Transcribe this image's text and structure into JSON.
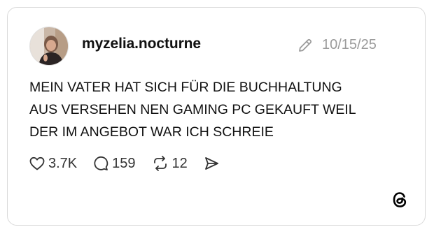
{
  "post": {
    "username": "myzelia.nocturne",
    "timestamp": "10/15/25",
    "text_lines": [
      "MEIN VATER HAT SICH FÜR DIE BUCHHALTUNG",
      "AUS VERSEHEN NEN GAMING PC GEKAUFT WEIL",
      "DER IM ANGEBOT WAR ICH SCHREIE"
    ]
  },
  "actions": {
    "likes": "3.7K",
    "replies": "159",
    "reposts": "12"
  },
  "icons": {
    "edit": "pencil-icon",
    "like": "heart-icon",
    "reply": "speech-bubble-icon",
    "repost": "repost-icon",
    "share": "send-icon",
    "brand": "threads-logo-icon"
  },
  "colors": {
    "text": "#111111",
    "muted": "#9b9b9b",
    "border": "#d9d9d9"
  }
}
